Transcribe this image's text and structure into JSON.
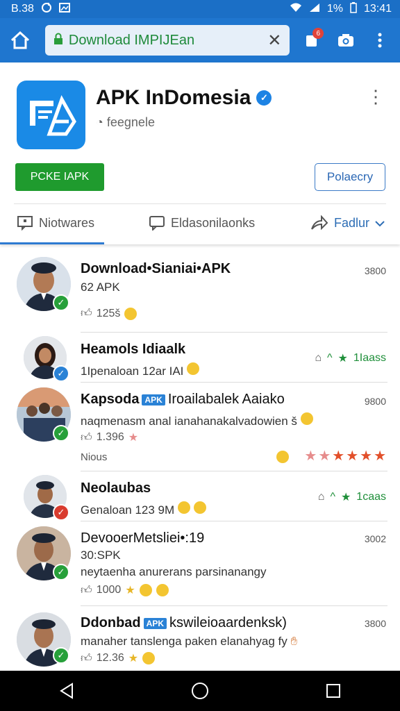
{
  "status_bar": {
    "time_left": "B.38",
    "battery": "1%",
    "time_right": "13:41"
  },
  "browser": {
    "url": "Download IMPIJEan",
    "tab_count": "6"
  },
  "app": {
    "title": "APK InDomesia",
    "subtitle": "feegnele",
    "primary_button": "PCKE IAPK",
    "secondary_button": "Polaecry"
  },
  "tabs": [
    {
      "label": "Niotwares",
      "icon": "comment-square-icon"
    },
    {
      "label": "Eldasonilaonks",
      "icon": "chat-bubble-icon"
    },
    {
      "label": "Fadlur",
      "icon": "share-icon"
    }
  ],
  "feed": [
    {
      "name": "Download•Sianiai•APK",
      "line1": "62 APK",
      "likes": "125š",
      "number": "3800",
      "badge_color": "#27a03a"
    },
    {
      "name": "Heamols Idiaalk",
      "line1": "1Ipenaloan 12ar IAI",
      "rating": "1Iaass",
      "badge_color": "#2a82d6"
    },
    {
      "name": "Kapsoda",
      "tag": "APK",
      "name_rest": "Iroailabalek Aaiako",
      "line1": "naqmenasm anal ianahanakalvadowien š",
      "likes": "1.396",
      "footer": "Nious",
      "number": "9800",
      "badge_color": "#27a03a"
    },
    {
      "name": "Neolaubas",
      "line1": "Genaloan 123 9M",
      "rating": "1caas",
      "badge_color": "#d93c2f"
    },
    {
      "name": "DevooerMetsliei•:19",
      "line1": "30:SPK",
      "line2": "neytaenha anurerans parsinanangy",
      "likes": "1000",
      "number": "3002",
      "badge_color": "#27a03a"
    },
    {
      "name": "Ddonbad",
      "tag": "APK",
      "name_rest": "kswileioaardenksk)",
      "line1": "manaher tanslenga paken elanahyag fy",
      "likes": "12.36",
      "number": "3800",
      "badge_color": "#27a03a"
    }
  ]
}
